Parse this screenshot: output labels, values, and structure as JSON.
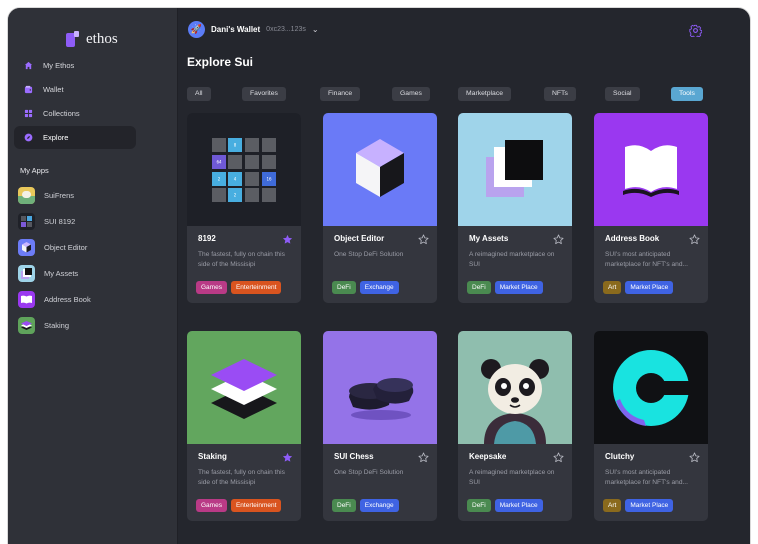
{
  "app": {
    "logo_text": "ethos"
  },
  "sidebar": {
    "nav": [
      {
        "label": "My Ethos",
        "icon": "home-icon"
      },
      {
        "label": "Wallet",
        "icon": "wallet-icon"
      },
      {
        "label": "Collections",
        "icon": "grid-icon"
      },
      {
        "label": "Explore",
        "icon": "compass-icon",
        "active": true
      }
    ],
    "apps_title": "My Apps",
    "apps": [
      {
        "label": "SuiFrens",
        "icon": "suifrens-app-icon"
      },
      {
        "label": "SUI 8192",
        "icon": "sui-8192-app-icon"
      },
      {
        "label": "Object Editor",
        "icon": "object-editor-app-icon"
      },
      {
        "label": "My Assets",
        "icon": "my-assets-app-icon"
      },
      {
        "label": "Address Book",
        "icon": "address-book-app-icon"
      },
      {
        "label": "Staking",
        "icon": "staking-app-icon"
      }
    ]
  },
  "topbar": {
    "wallet_name": "Dani's Wallet",
    "wallet_address": "0xc23...123s",
    "settings_icon": "gear-icon"
  },
  "page": {
    "title": "Explore Sui"
  },
  "filters": [
    "All",
    "Favorites",
    "Finance",
    "Games",
    "Marketplace",
    "NFTs",
    "Social",
    "Tools"
  ],
  "active_filter": "Tools",
  "colors": {
    "accent": "#8e5cf7",
    "active_chip": "#5aa7d2",
    "tag_games": "#b93a86",
    "tag_entertainment": "#d9541f",
    "tag_defi": "#4a8a50",
    "tag_exchange": "#3f63e3",
    "tag_art": "#8a6a1d"
  },
  "cards": [
    {
      "title": "8192",
      "favorite": true,
      "image": "8192-game-grid",
      "description": "The fastest, fully on chain this side of the Missisipi",
      "tags": [
        "Games",
        "Enterteinment"
      ],
      "tile_labels": [
        "8",
        "64",
        "2",
        "4",
        "16",
        "2"
      ]
    },
    {
      "title": "Object Editor",
      "favorite": false,
      "image": "cube-illustration",
      "description": "One Stop DeFi Solution",
      "tags": [
        "DeFi",
        "Exchange"
      ]
    },
    {
      "title": "My Assets",
      "favorite": false,
      "image": "stacked-squares-illustration",
      "description": "A reimagined marketplace on SUI",
      "tags": [
        "DeFi",
        "Market Place"
      ]
    },
    {
      "title": "Address Book",
      "favorite": false,
      "image": "open-book-illustration",
      "description": "SUI's most anticipated marketplace for NFT's and...",
      "tags": [
        "Art",
        "Market Place"
      ]
    },
    {
      "title": "Staking",
      "favorite": true,
      "image": "stacked-layers-illustration",
      "description": "The fastest, fully on chain this side of the Missisipi",
      "tags": [
        "Games",
        "Enterteinment"
      ]
    },
    {
      "title": "SUI Chess",
      "favorite": false,
      "image": "chess-pieces-render",
      "description": "One Stop DeFi Solution",
      "tags": [
        "DeFi",
        "Exchange"
      ]
    },
    {
      "title": "Keepsake",
      "favorite": false,
      "image": "panda-illustration",
      "description": "A reimagined marketplace on SUI",
      "tags": [
        "DeFi",
        "Market Place"
      ]
    },
    {
      "title": "Clutchy",
      "favorite": false,
      "image": "clutchy-logo",
      "description": "SUI's most anticipated marketplace for NFT's and...",
      "tags": [
        "Art",
        "Market Place"
      ]
    }
  ]
}
